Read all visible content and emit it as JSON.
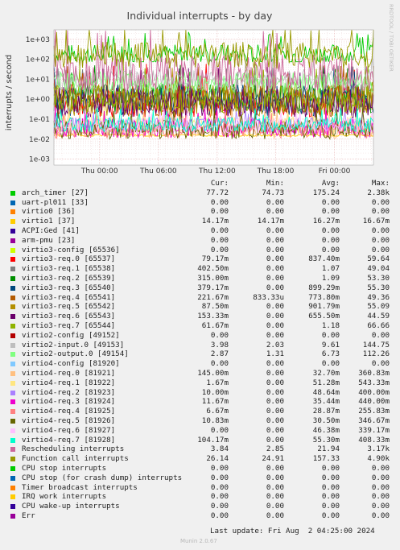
{
  "chart_data": {
    "type": "line",
    "title": "Individual interrupts - by day",
    "ylabel": "interrupts / second",
    "y_scale": "log",
    "y_ticks": [
      "1e+03",
      "1e+02",
      "1e+01",
      "1e+00",
      "1e-01",
      "1e-02",
      "1e-03"
    ],
    "y_tick_values": [
      1000,
      100,
      10,
      1,
      0.1,
      0.01,
      0.001
    ],
    "ylim": [
      0.0005,
      3000
    ],
    "x_ticks": [
      "Thu 00:00",
      "Thu 06:00",
      "Thu 12:00",
      "Thu 18:00",
      "Fri 00:00"
    ],
    "grid": true,
    "watermark": "RRDTOOL / TOBI OETIKER",
    "columns": [
      "Cur:",
      "Min:",
      "Avg:",
      "Max:"
    ],
    "series": [
      {
        "name": "arch_timer [27]",
        "color": "#00cc00",
        "cur": "77.72",
        "min": "74.73",
        "avg": "175.24",
        "max": "2.38k"
      },
      {
        "name": "uart-pl011 [33]",
        "color": "#0066b3",
        "cur": "0.00",
        "min": "0.00",
        "avg": "0.00",
        "max": "0.00"
      },
      {
        "name": "virtio0 [36]",
        "color": "#ff8000",
        "cur": "0.00",
        "min": "0.00",
        "avg": "0.00",
        "max": "0.00"
      },
      {
        "name": "virtio1 [37]",
        "color": "#ffcc00",
        "cur": "14.17m",
        "min": "14.17m",
        "avg": "16.27m",
        "max": "16.67m"
      },
      {
        "name": "ACPI:Ged [41]",
        "color": "#330099",
        "cur": "0.00",
        "min": "0.00",
        "avg": "0.00",
        "max": "0.00"
      },
      {
        "name": "arm-pmu [23]",
        "color": "#990099",
        "cur": "0.00",
        "min": "0.00",
        "avg": "0.00",
        "max": "0.00"
      },
      {
        "name": "virtio3-config [65536]",
        "color": "#ccff00",
        "cur": "0.00",
        "min": "0.00",
        "avg": "0.00",
        "max": "0.00"
      },
      {
        "name": "virtio3-req.0 [65537]",
        "color": "#ff0000",
        "cur": "79.17m",
        "min": "0.00",
        "avg": "837.40m",
        "max": "59.64"
      },
      {
        "name": "virtio3-req.1 [65538]",
        "color": "#808080",
        "cur": "402.50m",
        "min": "0.00",
        "avg": "1.07",
        "max": "49.04"
      },
      {
        "name": "virtio3-req.2 [65539]",
        "color": "#008f00",
        "cur": "315.00m",
        "min": "0.00",
        "avg": "1.09",
        "max": "53.30"
      },
      {
        "name": "virtio3-req.3 [65540]",
        "color": "#00487d",
        "cur": "379.17m",
        "min": "0.00",
        "avg": "899.29m",
        "max": "55.30"
      },
      {
        "name": "virtio3-req.4 [65541]",
        "color": "#b35a00",
        "cur": "221.67m",
        "min": "833.33u",
        "avg": "773.80m",
        "max": "49.36"
      },
      {
        "name": "virtio3-req.5 [65542]",
        "color": "#b38f00",
        "cur": "87.50m",
        "min": "0.00",
        "avg": "901.79m",
        "max": "55.09"
      },
      {
        "name": "virtio3-req.6 [65543]",
        "color": "#6b006b",
        "cur": "153.33m",
        "min": "0.00",
        "avg": "655.50m",
        "max": "44.59"
      },
      {
        "name": "virtio3-req.7 [65544]",
        "color": "#8fb300",
        "cur": "61.67m",
        "min": "0.00",
        "avg": "1.18",
        "max": "66.66"
      },
      {
        "name": "virtio2-config [49152]",
        "color": "#b30000",
        "cur": "0.00",
        "min": "0.00",
        "avg": "0.00",
        "max": "0.00"
      },
      {
        "name": "virtio2-input.0 [49153]",
        "color": "#bebebe",
        "cur": "3.98",
        "min": "2.03",
        "avg": "9.61",
        "max": "144.75"
      },
      {
        "name": "virtio2-output.0 [49154]",
        "color": "#80ff80",
        "cur": "2.87",
        "min": "1.31",
        "avg": "6.73",
        "max": "112.26"
      },
      {
        "name": "virtio4-config [81920]",
        "color": "#80c9ff",
        "cur": "0.00",
        "min": "0.00",
        "avg": "0.00",
        "max": "0.00"
      },
      {
        "name": "virtio4-req.0 [81921]",
        "color": "#ffc080",
        "cur": "145.00m",
        "min": "0.00",
        "avg": "32.70m",
        "max": "360.83m"
      },
      {
        "name": "virtio4-req.1 [81922]",
        "color": "#ffe680",
        "cur": "1.67m",
        "min": "0.00",
        "avg": "51.28m",
        "max": "543.33m"
      },
      {
        "name": "virtio4-req.2 [81923]",
        "color": "#aa80ff",
        "cur": "10.00m",
        "min": "0.00",
        "avg": "48.64m",
        "max": "400.00m"
      },
      {
        "name": "virtio4-req.3 [81924]",
        "color": "#ee00cc",
        "cur": "11.67m",
        "min": "0.00",
        "avg": "35.44m",
        "max": "440.00m"
      },
      {
        "name": "virtio4-req.4 [81925]",
        "color": "#ff8080",
        "cur": "6.67m",
        "min": "0.00",
        "avg": "28.87m",
        "max": "255.83m"
      },
      {
        "name": "virtio4-req.5 [81926]",
        "color": "#666600",
        "cur": "10.83m",
        "min": "0.00",
        "avg": "30.50m",
        "max": "346.67m"
      },
      {
        "name": "virtio4-req.6 [81927]",
        "color": "#ffbfff",
        "cur": "0.00",
        "min": "0.00",
        "avg": "46.38m",
        "max": "339.17m"
      },
      {
        "name": "virtio4-req.7 [81928]",
        "color": "#00ffcc",
        "cur": "104.17m",
        "min": "0.00",
        "avg": "55.30m",
        "max": "408.33m"
      },
      {
        "name": "Rescheduling interrupts",
        "color": "#cc6699",
        "cur": "3.84",
        "min": "2.85",
        "avg": "21.94",
        "max": "3.17k"
      },
      {
        "name": "Function call interrupts",
        "color": "#999900",
        "cur": "26.14",
        "min": "24.91",
        "avg": "157.33",
        "max": "4.90k"
      },
      {
        "name": "CPU stop interrupts",
        "color": "#00cc00",
        "cur": "0.00",
        "min": "0.00",
        "avg": "0.00",
        "max": "0.00"
      },
      {
        "name": "CPU stop (for crash dump) interrupts",
        "color": "#0066b3",
        "cur": "0.00",
        "min": "0.00",
        "avg": "0.00",
        "max": "0.00"
      },
      {
        "name": "Timer broadcast interrupts",
        "color": "#ff8000",
        "cur": "0.00",
        "min": "0.00",
        "avg": "0.00",
        "max": "0.00"
      },
      {
        "name": "IRQ work interrupts",
        "color": "#ffcc00",
        "cur": "0.00",
        "min": "0.00",
        "avg": "0.00",
        "max": "0.00"
      },
      {
        "name": "CPU wake-up interrupts",
        "color": "#330099",
        "cur": "0.00",
        "min": "0.00",
        "avg": "0.00",
        "max": "0.00"
      },
      {
        "name": "Err",
        "color": "#990099",
        "cur": "0.00",
        "min": "0.00",
        "avg": "0.00",
        "max": "0.00"
      }
    ]
  },
  "footer": {
    "last_update": "Last update: Fri Aug  2 04:25:00 2024",
    "generator": "Munin 2.0.67"
  }
}
